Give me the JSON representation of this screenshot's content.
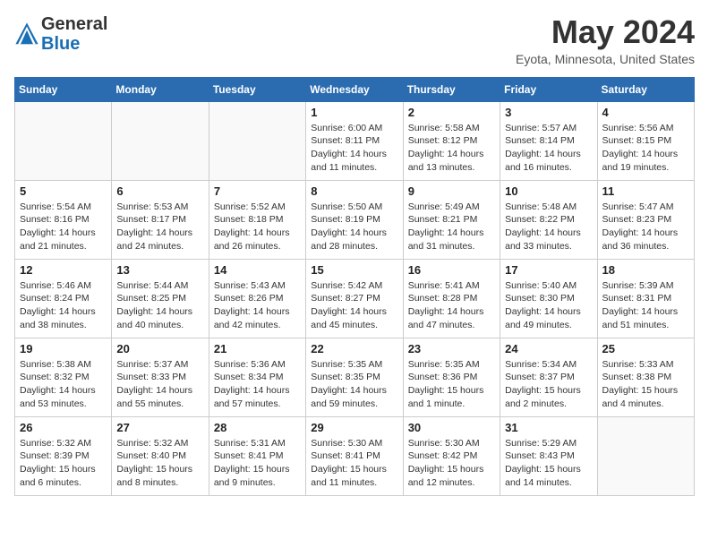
{
  "header": {
    "logo_line1": "General",
    "logo_line2": "Blue",
    "month_title": "May 2024",
    "location": "Eyota, Minnesota, United States"
  },
  "weekdays": [
    "Sunday",
    "Monday",
    "Tuesday",
    "Wednesday",
    "Thursday",
    "Friday",
    "Saturday"
  ],
  "weeks": [
    [
      {
        "day": "",
        "info": ""
      },
      {
        "day": "",
        "info": ""
      },
      {
        "day": "",
        "info": ""
      },
      {
        "day": "1",
        "info": "Sunrise: 6:00 AM\nSunset: 8:11 PM\nDaylight: 14 hours\nand 11 minutes."
      },
      {
        "day": "2",
        "info": "Sunrise: 5:58 AM\nSunset: 8:12 PM\nDaylight: 14 hours\nand 13 minutes."
      },
      {
        "day": "3",
        "info": "Sunrise: 5:57 AM\nSunset: 8:14 PM\nDaylight: 14 hours\nand 16 minutes."
      },
      {
        "day": "4",
        "info": "Sunrise: 5:56 AM\nSunset: 8:15 PM\nDaylight: 14 hours\nand 19 minutes."
      }
    ],
    [
      {
        "day": "5",
        "info": "Sunrise: 5:54 AM\nSunset: 8:16 PM\nDaylight: 14 hours\nand 21 minutes."
      },
      {
        "day": "6",
        "info": "Sunrise: 5:53 AM\nSunset: 8:17 PM\nDaylight: 14 hours\nand 24 minutes."
      },
      {
        "day": "7",
        "info": "Sunrise: 5:52 AM\nSunset: 8:18 PM\nDaylight: 14 hours\nand 26 minutes."
      },
      {
        "day": "8",
        "info": "Sunrise: 5:50 AM\nSunset: 8:19 PM\nDaylight: 14 hours\nand 28 minutes."
      },
      {
        "day": "9",
        "info": "Sunrise: 5:49 AM\nSunset: 8:21 PM\nDaylight: 14 hours\nand 31 minutes."
      },
      {
        "day": "10",
        "info": "Sunrise: 5:48 AM\nSunset: 8:22 PM\nDaylight: 14 hours\nand 33 minutes."
      },
      {
        "day": "11",
        "info": "Sunrise: 5:47 AM\nSunset: 8:23 PM\nDaylight: 14 hours\nand 36 minutes."
      }
    ],
    [
      {
        "day": "12",
        "info": "Sunrise: 5:46 AM\nSunset: 8:24 PM\nDaylight: 14 hours\nand 38 minutes."
      },
      {
        "day": "13",
        "info": "Sunrise: 5:44 AM\nSunset: 8:25 PM\nDaylight: 14 hours\nand 40 minutes."
      },
      {
        "day": "14",
        "info": "Sunrise: 5:43 AM\nSunset: 8:26 PM\nDaylight: 14 hours\nand 42 minutes."
      },
      {
        "day": "15",
        "info": "Sunrise: 5:42 AM\nSunset: 8:27 PM\nDaylight: 14 hours\nand 45 minutes."
      },
      {
        "day": "16",
        "info": "Sunrise: 5:41 AM\nSunset: 8:28 PM\nDaylight: 14 hours\nand 47 minutes."
      },
      {
        "day": "17",
        "info": "Sunrise: 5:40 AM\nSunset: 8:30 PM\nDaylight: 14 hours\nand 49 minutes."
      },
      {
        "day": "18",
        "info": "Sunrise: 5:39 AM\nSunset: 8:31 PM\nDaylight: 14 hours\nand 51 minutes."
      }
    ],
    [
      {
        "day": "19",
        "info": "Sunrise: 5:38 AM\nSunset: 8:32 PM\nDaylight: 14 hours\nand 53 minutes."
      },
      {
        "day": "20",
        "info": "Sunrise: 5:37 AM\nSunset: 8:33 PM\nDaylight: 14 hours\nand 55 minutes."
      },
      {
        "day": "21",
        "info": "Sunrise: 5:36 AM\nSunset: 8:34 PM\nDaylight: 14 hours\nand 57 minutes."
      },
      {
        "day": "22",
        "info": "Sunrise: 5:35 AM\nSunset: 8:35 PM\nDaylight: 14 hours\nand 59 minutes."
      },
      {
        "day": "23",
        "info": "Sunrise: 5:35 AM\nSunset: 8:36 PM\nDaylight: 15 hours\nand 1 minute."
      },
      {
        "day": "24",
        "info": "Sunrise: 5:34 AM\nSunset: 8:37 PM\nDaylight: 15 hours\nand 2 minutes."
      },
      {
        "day": "25",
        "info": "Sunrise: 5:33 AM\nSunset: 8:38 PM\nDaylight: 15 hours\nand 4 minutes."
      }
    ],
    [
      {
        "day": "26",
        "info": "Sunrise: 5:32 AM\nSunset: 8:39 PM\nDaylight: 15 hours\nand 6 minutes."
      },
      {
        "day": "27",
        "info": "Sunrise: 5:32 AM\nSunset: 8:40 PM\nDaylight: 15 hours\nand 8 minutes."
      },
      {
        "day": "28",
        "info": "Sunrise: 5:31 AM\nSunset: 8:41 PM\nDaylight: 15 hours\nand 9 minutes."
      },
      {
        "day": "29",
        "info": "Sunrise: 5:30 AM\nSunset: 8:41 PM\nDaylight: 15 hours\nand 11 minutes."
      },
      {
        "day": "30",
        "info": "Sunrise: 5:30 AM\nSunset: 8:42 PM\nDaylight: 15 hours\nand 12 minutes."
      },
      {
        "day": "31",
        "info": "Sunrise: 5:29 AM\nSunset: 8:43 PM\nDaylight: 15 hours\nand 14 minutes."
      },
      {
        "day": "",
        "info": ""
      }
    ]
  ]
}
